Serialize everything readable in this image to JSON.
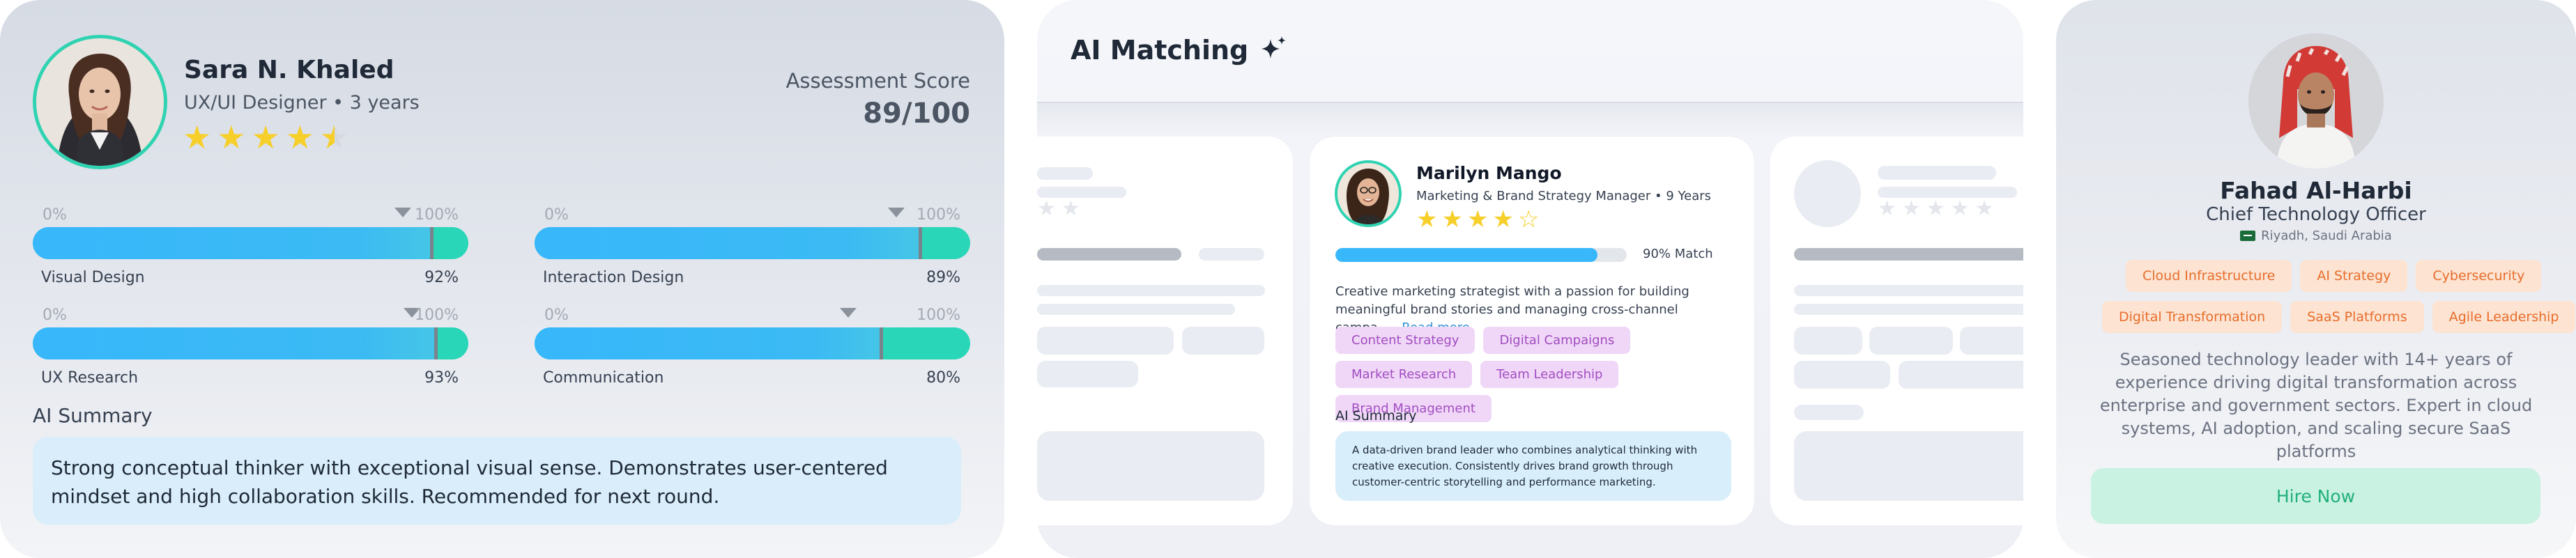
{
  "assessment": {
    "candidate_name": "Sara N. Khaled",
    "candidate_role": "UX/UI Designer • 3 years",
    "rating_stars": 4.5,
    "score_label": "Assessment Score",
    "score_value": "89/100",
    "scale_start": "0%",
    "scale_end": "100%",
    "skills": [
      {
        "label": "Visual Design",
        "value_text": "92%",
        "value": 92,
        "benchmark": 85
      },
      {
        "label": "Interaction Design",
        "value_text": "89%",
        "value": 89,
        "benchmark": 83
      },
      {
        "label": "UX Research",
        "value_text": "93%",
        "value": 93,
        "benchmark": 87
      },
      {
        "label": "Communication",
        "value_text": "80%",
        "value": 80,
        "benchmark": 72
      }
    ],
    "ai_summary_title": "AI Summary",
    "ai_summary_text": "Strong conceptual thinker with exceptional visual sense. Demonstrates user-centered mindset and high collaboration skills. Recommended for next round.",
    "colors": {
      "accent_teal": "#2ad6b8",
      "accent_blue": "#38b7fb",
      "star": "#f6cf2b"
    }
  },
  "matching": {
    "title": "AI Matching",
    "title_icon": "sparkle-icon",
    "featured": {
      "name": "Marilyn Mango",
      "role": "Marketing & Brand Strategy Manager",
      "experience": "9 Years",
      "rating_stars": 4,
      "match_percent": 90,
      "match_label": "90% Match",
      "description": "Creative marketing strategist with a passion for building meaningful brand stories and managing cross-channel campa.....",
      "read_more": "Read more",
      "tags": [
        "Content Strategy",
        "Digital Campaigns",
        "Market Research",
        "Team Leadership",
        "Brand Management"
      ],
      "ai_summary_title": "AI Summary",
      "ai_summary_text": "A data-driven brand leader who combines analytical thinking with creative execution. Consistently drives brand growth through customer-centric storytelling and performance marketing."
    }
  },
  "profile": {
    "name": "Fahad Al-Harbi",
    "title": "Chief Technology Officer",
    "location": "Riyadh, Saudi Arabia",
    "skills_row_1": [
      "Cloud Infrastructure",
      "AI Strategy",
      "Cybersecurity"
    ],
    "skills_row_2": [
      "Digital Transformation",
      "SaaS Platforms",
      "Agile Leadership"
    ],
    "bio": "Seasoned technology leader with 14+ years of experience driving digital transformation across enterprise and government sectors. Expert in cloud systems, AI adoption, and scaling secure SaaS platforms",
    "hire_label": "Hire Now",
    "colors": {
      "chip_bg": "#fce3d2",
      "chip_text": "#e86d2a",
      "hire_bg": "#c9f2e3",
      "hire_text": "#22b07a"
    }
  }
}
